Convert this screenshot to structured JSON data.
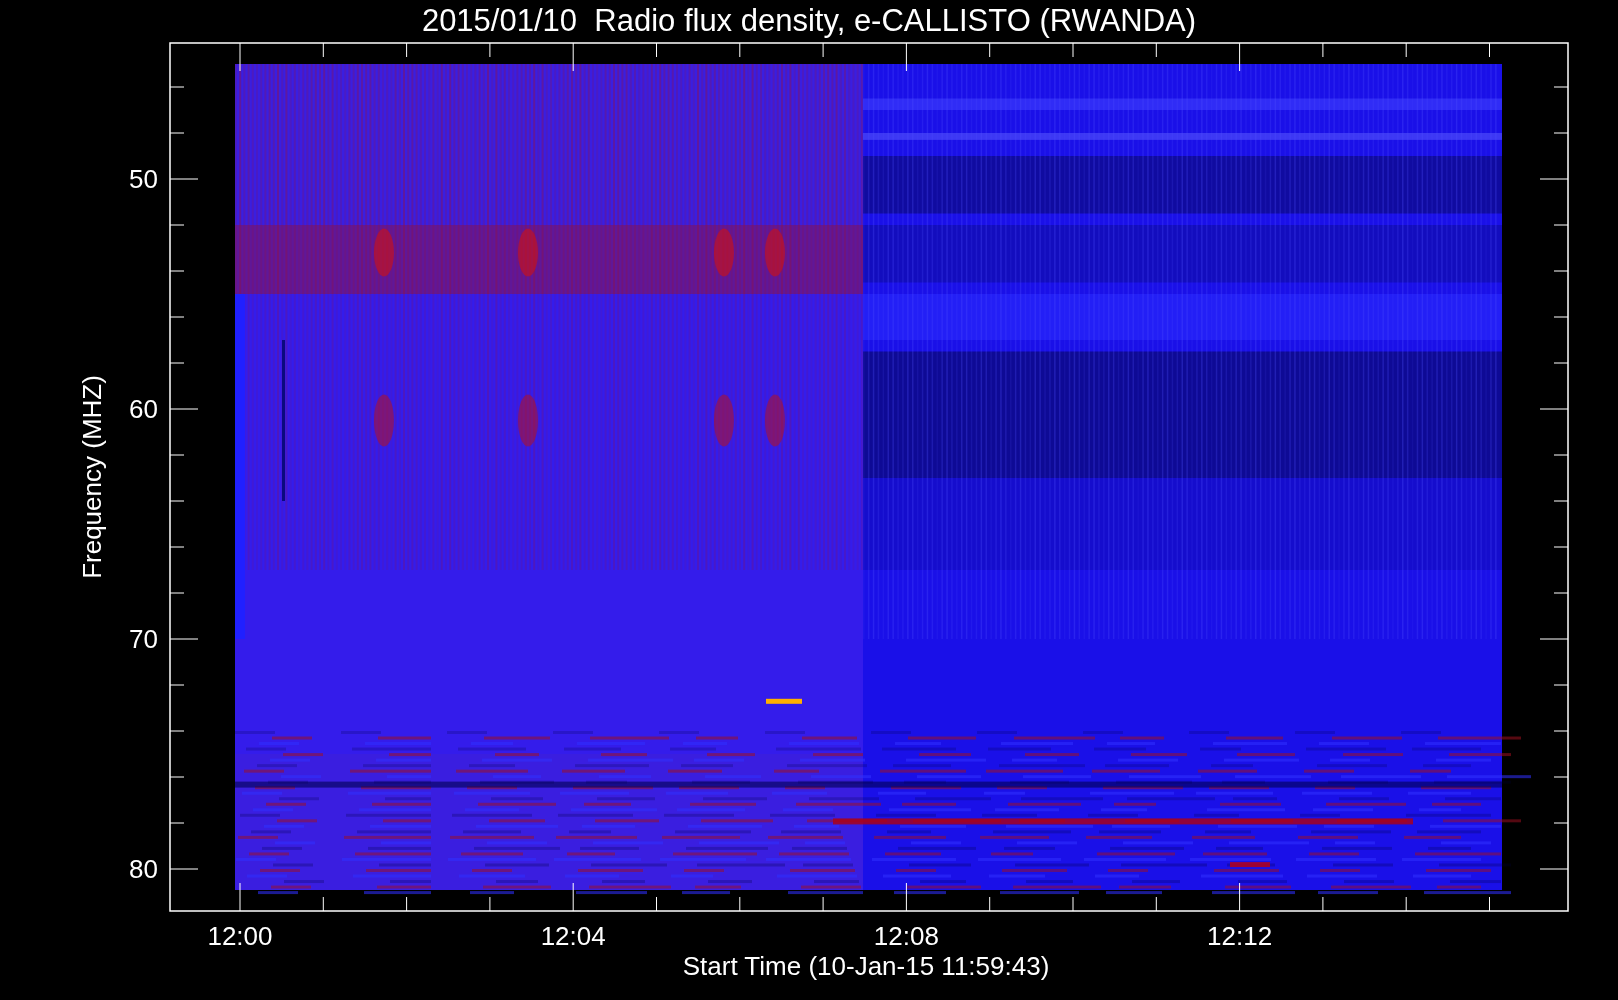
{
  "title": "2015/01/10  Radio flux density, e-CALLISTO (RWANDA)",
  "y_axis": {
    "label": "Frequency (MHZ)",
    "ticks": [
      "50",
      "60",
      "70",
      "80"
    ]
  },
  "x_axis": {
    "label": "Start Time (10-Jan-15 11:59:43)",
    "ticks": [
      "12:00",
      "12:04",
      "12:08",
      "12:12"
    ]
  }
}
